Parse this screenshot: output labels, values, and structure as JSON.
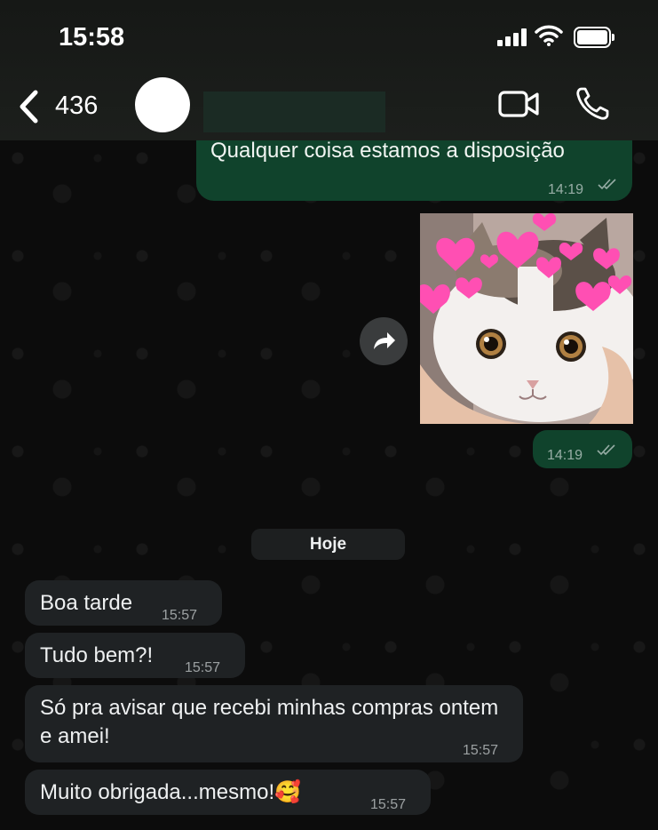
{
  "status_bar": {
    "time": "15:58"
  },
  "header": {
    "back_count": "436",
    "icons": {
      "back": "chevron-left-icon",
      "video": "video-call-icon",
      "voice": "phone-icon"
    }
  },
  "messages": [
    {
      "direction": "outgoing",
      "text": "Qualquer coisa estamos a disposição",
      "time": "14:19",
      "status": "read"
    },
    {
      "direction": "outgoing",
      "type": "image",
      "image_desc": "cat with pink hearts",
      "time": "14:19",
      "status": "read"
    }
  ],
  "day_divider": "Hoje",
  "incoming": [
    {
      "text": "Boa tarde",
      "time": "15:57"
    },
    {
      "text": "Tudo bem?!",
      "time": "15:57"
    },
    {
      "text": "Só pra avisar que recebi minhas compras ontem e amei!",
      "time": "15:57"
    },
    {
      "text": "Muito obrigada...mesmo!",
      "emoji": "🥰",
      "time": "15:57"
    }
  ],
  "colors": {
    "outgoing_bubble": "#10432c",
    "incoming_bubble": "#1f2224",
    "accent_hearts": "#ff4fb3"
  }
}
